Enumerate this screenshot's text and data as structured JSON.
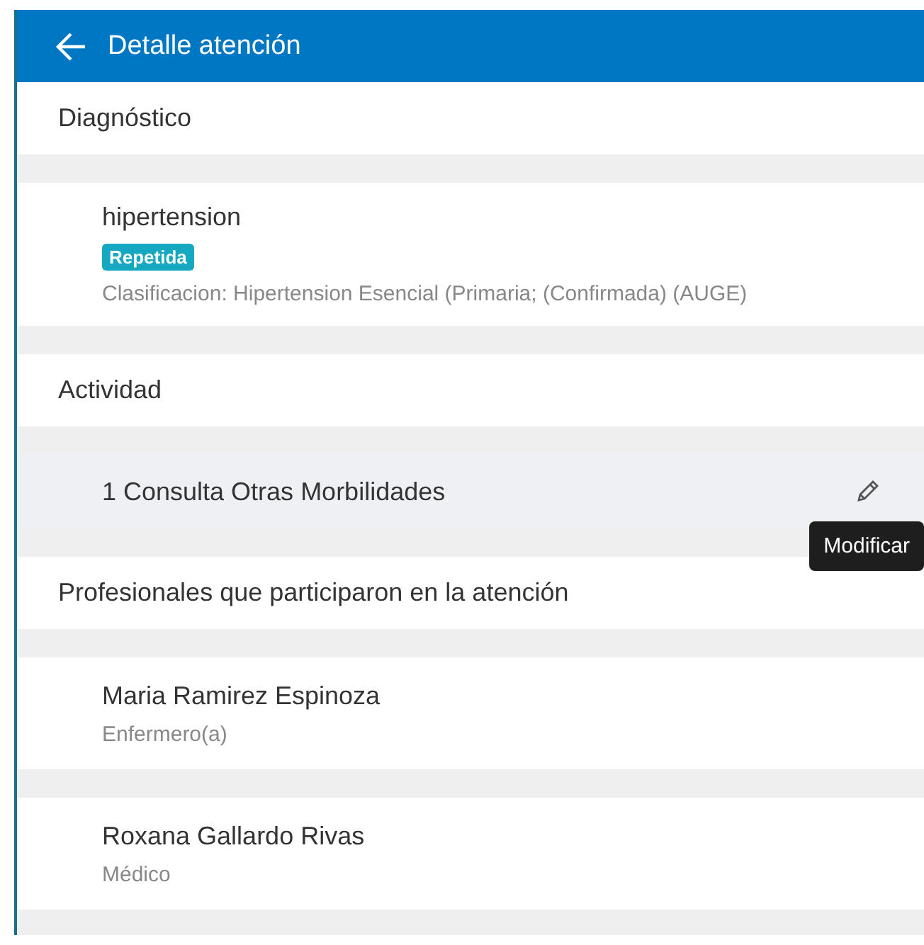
{
  "header": {
    "title": "Detalle atención"
  },
  "sections": [
    {
      "heading": "Diagnóstico",
      "items": [
        {
          "kind": "diagnosis",
          "title": "hipertension",
          "badge": "Repetida",
          "detail": "Clasificacion: Hipertension Esencial (Primaria; (Confirmada) (AUGE)"
        }
      ]
    },
    {
      "heading": "Actividad",
      "items": [
        {
          "kind": "activity",
          "title": "1 Consulta Otras Morbilidades",
          "hovered": true,
          "tooltip": "Modificar"
        }
      ]
    },
    {
      "heading": "Profesionales que participaron en la atención",
      "items": [
        {
          "kind": "professional",
          "title": "Maria Ramirez Espinoza",
          "detail": "Enfermero(a)"
        },
        {
          "kind": "professional",
          "title": "Roxana Gallardo Rivas",
          "detail": "Médico"
        }
      ]
    }
  ]
}
